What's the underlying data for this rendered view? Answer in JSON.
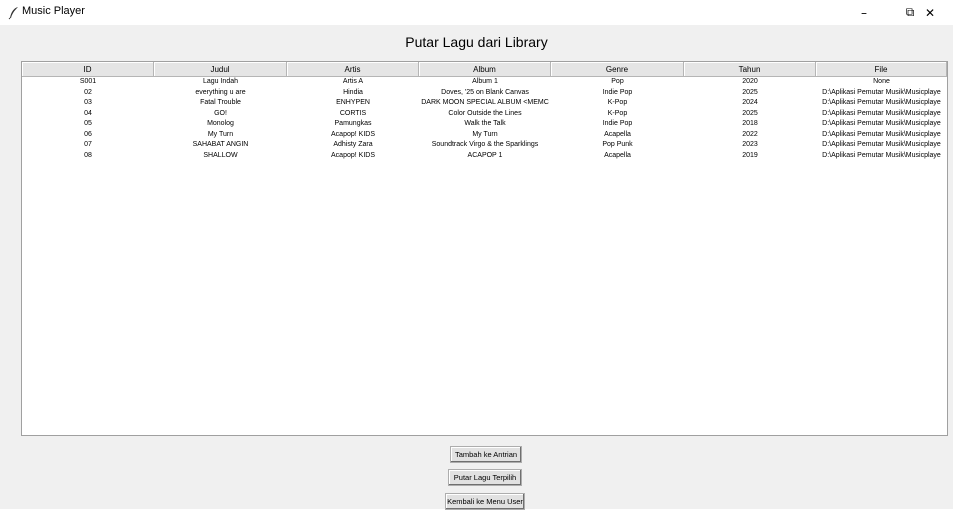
{
  "window": {
    "title": "Music Player",
    "minimize_glyph": "–",
    "maximize_glyph": "⧉",
    "close_glyph": "✕",
    "app_icon": "feather-icon"
  },
  "heading": "Putar Lagu dari Library",
  "table": {
    "columns": [
      "ID",
      "Judul",
      "Artis",
      "Album",
      "Genre",
      "Tahun",
      "File"
    ],
    "rows": [
      [
        "S001",
        "Lagu Indah",
        "Artis A",
        "Album 1",
        "Pop",
        "2020",
        "None"
      ],
      [
        "02",
        "everything u are",
        "Hindia",
        "Doves, '25 on Blank Canvas",
        "Indie Pop",
        "2025",
        "D:\\Aplikasi Pemutar Musik\\Musicplaye"
      ],
      [
        "03",
        "Fatal Trouble",
        "ENHYPEN",
        "DARK MOON SPECIAL ALBUM <MEMC",
        "K-Pop",
        "2024",
        "D:\\Aplikasi Pemutar Musik\\Musicplaye"
      ],
      [
        "04",
        "GO!",
        "CORTIS",
        "Color Outside the Lines",
        "K-Pop",
        "2025",
        "D:\\Aplikasi Pemutar Musik\\Musicplaye"
      ],
      [
        "05",
        "Monolog",
        "Pamungkas",
        "Walk the Talk",
        "Indie Pop",
        "2018",
        "D:\\Aplikasi Pemutar Musik\\Musicplaye"
      ],
      [
        "06",
        "My Turn",
        "Acapop! KIDS",
        "My Turn",
        "Acapella",
        "2022",
        "D:\\Aplikasi Pemutar Musik\\Musicplaye"
      ],
      [
        "07",
        "SAHABAT ANGIN",
        "Adhisty Zara",
        "Soundtrack Virgo & the Sparklings",
        "Pop Punk",
        "2023",
        "D:\\Aplikasi Pemutar Musik\\Musicplaye"
      ],
      [
        "08",
        "SHALLOW",
        "Acapop! KIDS",
        "ACAPOP 1",
        "Acapella",
        "2019",
        "D:\\Aplikasi Pemutar Musik\\Musicplaye"
      ]
    ]
  },
  "buttons": {
    "add_queue": "Tambah ke Antrian",
    "play_selected": "Putar Lagu Terpilih",
    "back_menu": "Kembali ke Menu User"
  }
}
